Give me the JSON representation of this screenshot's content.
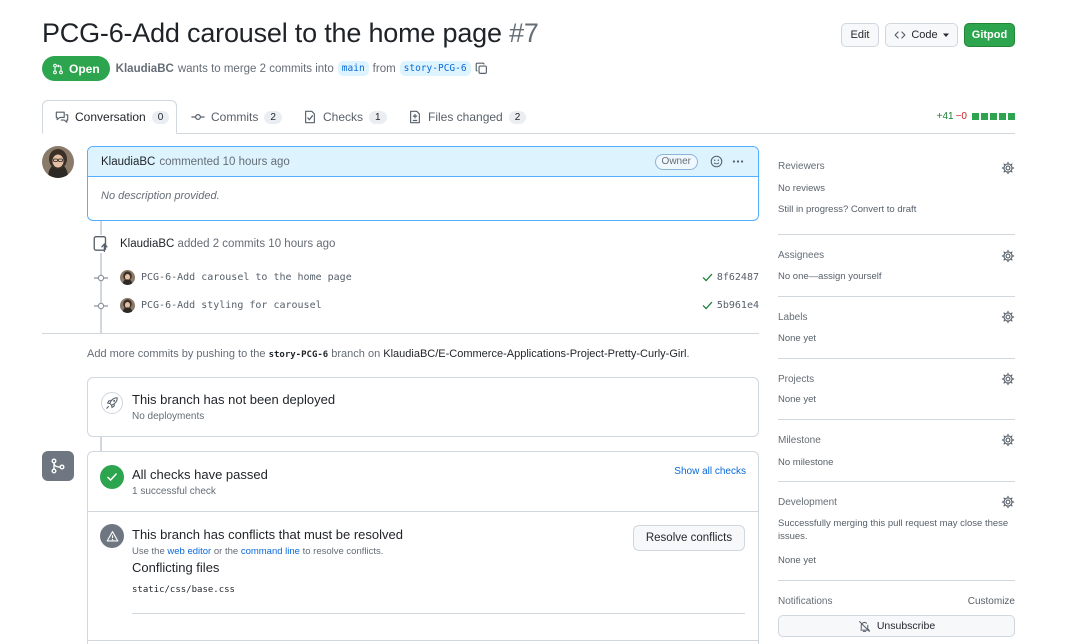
{
  "header": {
    "title": "PCG-6-Add carousel to the home page",
    "number": "#7",
    "edit_label": "Edit",
    "code_label": "Code",
    "gitpod_label": "Gitpod"
  },
  "state": {
    "label": "Open",
    "author": "KlaudiaBC",
    "text_merge": "wants to merge 2 commits into",
    "base_branch": "main",
    "text_from": "from",
    "head_branch": "story-PCG-6"
  },
  "tabs": [
    {
      "label": "Conversation",
      "count": "0"
    },
    {
      "label": "Commits",
      "count": "2"
    },
    {
      "label": "Checks",
      "count": "1"
    },
    {
      "label": "Files changed",
      "count": "2"
    }
  ],
  "diffstat": {
    "additions": "+41",
    "deletions": "−0"
  },
  "comment": {
    "author": "KlaudiaBC",
    "action": "commented 10 hours ago",
    "badge": "Owner",
    "body": "No description provided."
  },
  "commits_event": {
    "author": "KlaudiaBC",
    "text": "added 2 commits 10 hours ago",
    "commits": [
      {
        "message": "PCG-6-Add carousel to the home page",
        "sha": "8f62487"
      },
      {
        "message": "PCG-6-Add styling for carousel",
        "sha": "5b961e4"
      }
    ]
  },
  "hint": {
    "prefix": "Add more commits by pushing to the",
    "branch": "story-PCG-6",
    "middle": "branch on",
    "repo": "KlaudiaBC/E-Commerce-Applications-Project-Pretty-Curly-Girl",
    "suffix": "."
  },
  "deploy": {
    "title": "This branch has not been deployed",
    "subtitle": "No deployments"
  },
  "merge": {
    "checks_title": "All checks have passed",
    "checks_sub": "1 successful check",
    "show_checks": "Show all checks",
    "conflict_title": "This branch has conflicts that must be resolved",
    "conflict_sub_1": "Use the",
    "web_editor": "web editor",
    "conflict_sub_2": "or the",
    "command_line": "command line",
    "conflict_sub_3": "to resolve conflicts.",
    "resolve_label": "Resolve conflicts",
    "conflicting_files_title": "Conflicting files",
    "conflicting_file": "static/css/base.css"
  },
  "sidebar": {
    "reviewers": {
      "title": "Reviewers",
      "value": "No reviews",
      "extra": "Still in progress? Convert to draft"
    },
    "assignees": {
      "title": "Assignees",
      "value": "No one—assign yourself"
    },
    "labels": {
      "title": "Labels",
      "value": "None yet"
    },
    "projects": {
      "title": "Projects",
      "value": "None yet"
    },
    "milestone": {
      "title": "Milestone",
      "value": "No milestone"
    },
    "development": {
      "title": "Development",
      "value": "Successfully merging this pull request may close these issues.",
      "extra": "None yet"
    },
    "notifications": {
      "title": "Notifications",
      "customize": "Customize",
      "button": "Unsubscribe"
    }
  },
  "colors": {
    "accent": "#0969da",
    "success": "#2da44e",
    "border": "#d0d7de",
    "muted": "#656d76"
  },
  "icons": [
    "pull-request-icon",
    "copy-icon",
    "code-icon",
    "comment-icon",
    "commit-icon",
    "checks-icon",
    "files-icon",
    "smiley-icon",
    "kebab-icon",
    "repo-push-icon",
    "check-icon",
    "rocket-icon",
    "merge-icon",
    "alert-icon",
    "gear-icon",
    "bell-slash-icon"
  ]
}
